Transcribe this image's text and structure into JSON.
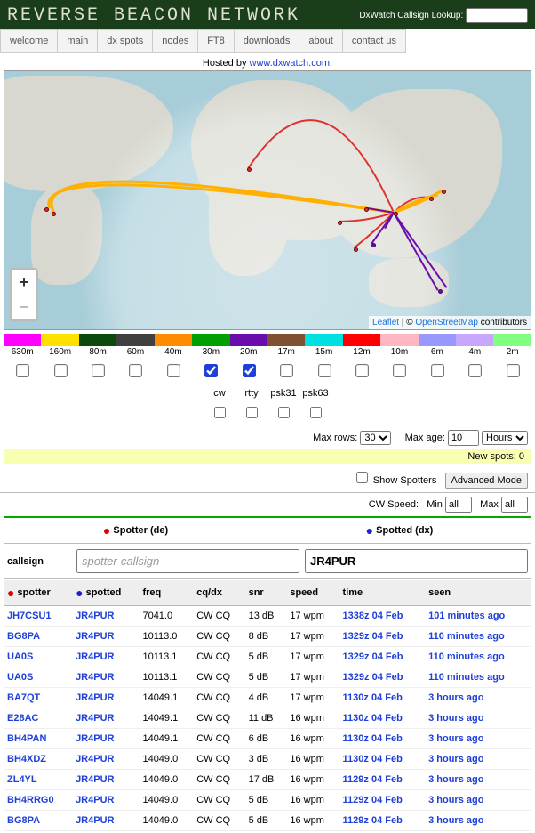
{
  "header": {
    "title": "REVERSE BEACON NETWORK",
    "lookup_label": "DxWatch Callsign Lookup:",
    "lookup_value": ""
  },
  "nav": [
    "welcome",
    "main",
    "dx spots",
    "nodes",
    "FT8",
    "downloads",
    "about",
    "contact us"
  ],
  "hosted": {
    "prefix": "Hosted by ",
    "link": "www.dxwatch.com",
    "suffix": "."
  },
  "map": {
    "zoom_in": "+",
    "zoom_out": "−",
    "leaflet": "Leaflet",
    "sep": " | © ",
    "osm": "OpenStreetMap",
    "tail": " contributors"
  },
  "bands": [
    {
      "label": "630m",
      "color": "#ff00ff",
      "checked": false
    },
    {
      "label": "160m",
      "color": "#ffe000",
      "checked": false
    },
    {
      "label": "80m",
      "color": "#0a4a0a",
      "checked": false
    },
    {
      "label": "60m",
      "color": "#404040",
      "checked": false
    },
    {
      "label": "40m",
      "color": "#ff8c00",
      "checked": false
    },
    {
      "label": "30m",
      "color": "#00a000",
      "checked": true
    },
    {
      "label": "20m",
      "color": "#6a0dad",
      "checked": true
    },
    {
      "label": "17m",
      "color": "#805030",
      "checked": false
    },
    {
      "label": "15m",
      "color": "#00e0e0",
      "checked": false
    },
    {
      "label": "12m",
      "color": "#ff0000",
      "checked": false
    },
    {
      "label": "10m",
      "color": "#ffb6c1",
      "checked": false
    },
    {
      "label": "6m",
      "color": "#9898ff",
      "checked": false
    },
    {
      "label": "4m",
      "color": "#c8a8ff",
      "checked": false
    },
    {
      "label": "2m",
      "color": "#80ff80",
      "checked": false
    }
  ],
  "modes": [
    {
      "label": "cw",
      "checked": false
    },
    {
      "label": "rtty",
      "checked": false
    },
    {
      "label": "psk31",
      "checked": false
    },
    {
      "label": "psk63",
      "checked": false
    }
  ],
  "controls": {
    "max_rows_label": "Max rows:",
    "max_rows_value": "30",
    "max_age_label": "Max age:",
    "max_age_value": "10",
    "max_age_unit": "Hours",
    "new_spots_label": "New spots: ",
    "new_spots_count": "0",
    "show_spotters_label": "Show Spotters",
    "advanced_btn": "Advanced Mode",
    "cw_speed_label": "CW Speed:",
    "min_label": "Min",
    "min_value": "all",
    "max_label": "Max",
    "max_value": "all"
  },
  "legend": {
    "spotter": "Spotter (de)",
    "spotted": "Spotted (dx)"
  },
  "callsign": {
    "label": "callsign",
    "spotter_placeholder": "spotter-callsign",
    "spotted_value": "JR4PUR"
  },
  "columns": {
    "spotter": "spotter",
    "spotted": "spotted",
    "freq": "freq",
    "cqdx": "cq/dx",
    "snr": "snr",
    "speed": "speed",
    "time": "time",
    "seen": "seen"
  },
  "rows": [
    {
      "spotter": "JH7CSU1",
      "spotted": "JR4PUR",
      "freq": "7041.0",
      "cqdx": "CW CQ",
      "snr": "13 dB",
      "speed": "17 wpm",
      "time": "1338z 04 Feb",
      "seen": "101 minutes ago"
    },
    {
      "spotter": "BG8PA",
      "spotted": "JR4PUR",
      "freq": "10113.0",
      "cqdx": "CW CQ",
      "snr": "8 dB",
      "speed": "17 wpm",
      "time": "1329z 04 Feb",
      "seen": "110 minutes ago"
    },
    {
      "spotter": "UA0S",
      "spotted": "JR4PUR",
      "freq": "10113.1",
      "cqdx": "CW CQ",
      "snr": "5 dB",
      "speed": "17 wpm",
      "time": "1329z 04 Feb",
      "seen": "110 minutes ago"
    },
    {
      "spotter": "UA0S",
      "spotted": "JR4PUR",
      "freq": "10113.1",
      "cqdx": "CW CQ",
      "snr": "5 dB",
      "speed": "17 wpm",
      "time": "1329z 04 Feb",
      "seen": "110 minutes ago"
    },
    {
      "spotter": "BA7QT",
      "spotted": "JR4PUR",
      "freq": "14049.1",
      "cqdx": "CW CQ",
      "snr": "4 dB",
      "speed": "17 wpm",
      "time": "1130z 04 Feb",
      "seen": "3 hours ago"
    },
    {
      "spotter": "E28AC",
      "spotted": "JR4PUR",
      "freq": "14049.1",
      "cqdx": "CW CQ",
      "snr": "11 dB",
      "speed": "16 wpm",
      "time": "1130z 04 Feb",
      "seen": "3 hours ago"
    },
    {
      "spotter": "BH4PAN",
      "spotted": "JR4PUR",
      "freq": "14049.1",
      "cqdx": "CW CQ",
      "snr": "6 dB",
      "speed": "16 wpm",
      "time": "1130z 04 Feb",
      "seen": "3 hours ago"
    },
    {
      "spotter": "BH4XDZ",
      "spotted": "JR4PUR",
      "freq": "14049.0",
      "cqdx": "CW CQ",
      "snr": "3 dB",
      "speed": "16 wpm",
      "time": "1130z 04 Feb",
      "seen": "3 hours ago"
    },
    {
      "spotter": "ZL4YL",
      "spotted": "JR4PUR",
      "freq": "14049.0",
      "cqdx": "CW CQ",
      "snr": "17 dB",
      "speed": "16 wpm",
      "time": "1129z 04 Feb",
      "seen": "3 hours ago"
    },
    {
      "spotter": "BH4RRG0",
      "spotted": "JR4PUR",
      "freq": "14049.0",
      "cqdx": "CW CQ",
      "snr": "5 dB",
      "speed": "16 wpm",
      "time": "1129z 04 Feb",
      "seen": "3 hours ago"
    },
    {
      "spotter": "BG8PA",
      "spotted": "JR4PUR",
      "freq": "14049.0",
      "cqdx": "CW CQ",
      "snr": "5 dB",
      "speed": "16 wpm",
      "time": "1129z 04 Feb",
      "seen": "3 hours ago"
    }
  ]
}
